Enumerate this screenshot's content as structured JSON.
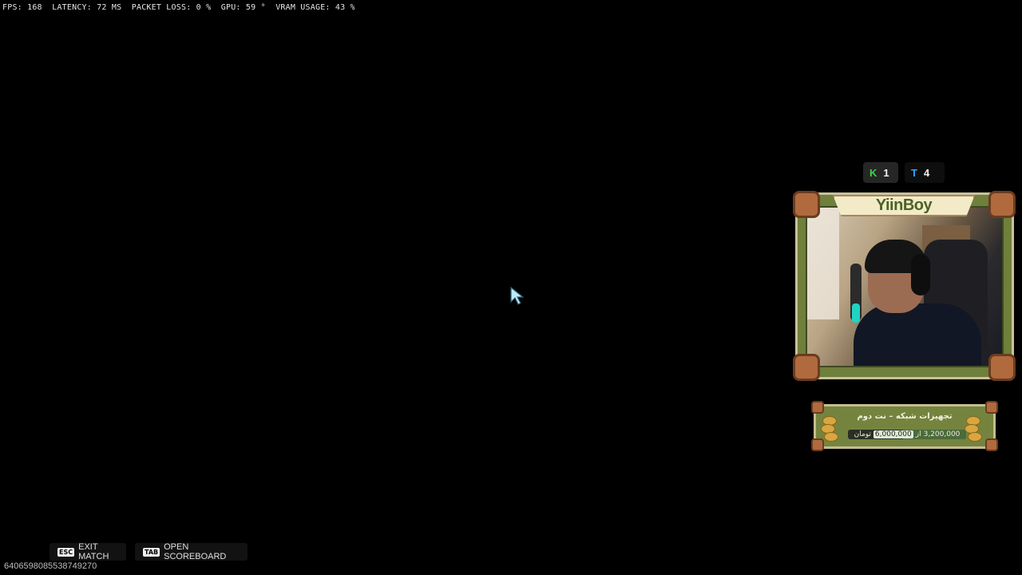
{
  "perf": {
    "fps": "FPS: 168",
    "latency": "LATENCY: 72 MS",
    "packet_loss": "PACKET LOSS: 0 %",
    "gpu": "GPU: 59 °",
    "vram": "VRAM USAGE: 43 %"
  },
  "scores": {
    "team_k": {
      "glyph": "K",
      "value": "1",
      "color": "#39d64a"
    },
    "team_t": {
      "glyph": "T",
      "value": "4",
      "color": "#2fa6ff"
    }
  },
  "webcam": {
    "streamer_name": "YiinBoy"
  },
  "donation_goal": {
    "title": "تجهیزات شبکه – نت دوم",
    "current": "3,200,000",
    "separator": "از",
    "target": "6,000,000",
    "currency": "تومان",
    "progress_fraction": 0.533
  },
  "hints": {
    "exit": {
      "key": "ESC",
      "label": "EXIT MATCH"
    },
    "scoreboard": {
      "key": "TAB",
      "label": "OPEN SCOREBOARD"
    }
  },
  "session_id": "640659808553874927​0",
  "icons": {
    "cursor": "mouse-pointer-icon",
    "coins": "coin-stack-icon"
  }
}
